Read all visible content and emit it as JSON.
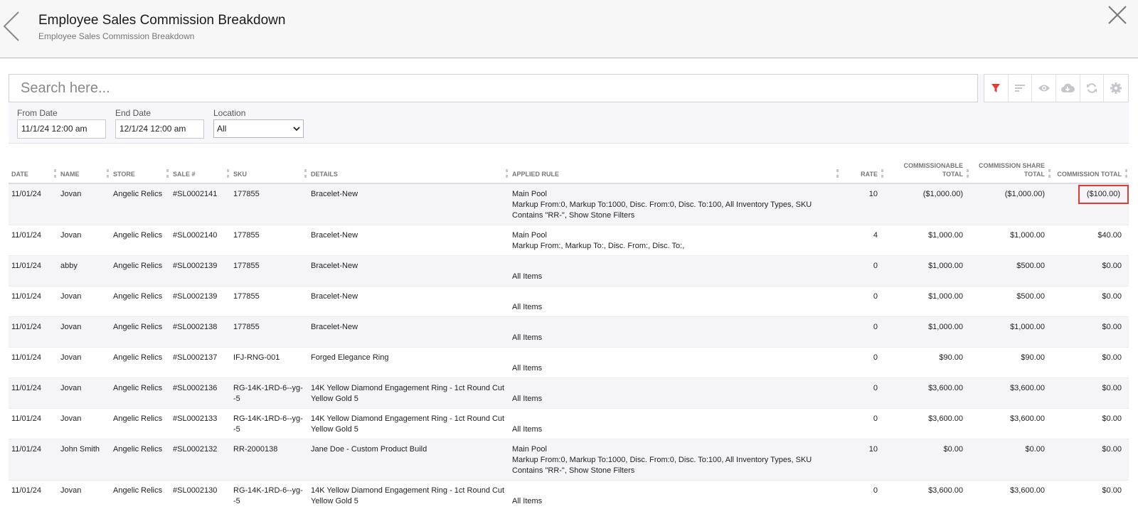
{
  "header": {
    "title": "Employee Sales Commission Breakdown",
    "subtitle": "Employee Sales Commission Breakdown"
  },
  "search": {
    "placeholder": "Search here..."
  },
  "toolbar": {
    "icons": [
      "filter-icon",
      "sort-icon",
      "eye-icon",
      "cloud-download-icon",
      "refresh-icon",
      "gear-icon"
    ],
    "active_color": "#e53935"
  },
  "filters": {
    "from_date_label": "From Date",
    "from_date_value": "11/1/24 12:00 am",
    "end_date_label": "End Date",
    "end_date_value": "12/1/24 12:00 am",
    "location_label": "Location",
    "location_value": "All"
  },
  "table": {
    "columns": [
      "DATE",
      "NAME",
      "STORE",
      "SALE #",
      "SKU",
      "DETAILS",
      "APPLIED RULE",
      "RATE",
      "COMMISSIONABLE TOTAL",
      "COMMISSION SHARE TOTAL",
      "COMMISSION TOTAL"
    ],
    "rows": [
      {
        "date": "11/01/24",
        "name": "Jovan",
        "store": "Angelic Relics",
        "sale": "#SL0002141",
        "sku": "177855",
        "details": "Bracelet-New",
        "rule_name": "Main Pool",
        "rule_desc": "Markup From:0, Markup To:1000, Disc. From:0, Disc. To:100, All Inventory Types, SKU Contains \"RR-\", Show Stone Filters",
        "rate": "10",
        "commissionable": "($1,000.00)",
        "share": "($1,000.00)",
        "commission": "($100.00)"
      },
      {
        "date": "11/01/24",
        "name": "Jovan",
        "store": "Angelic Relics",
        "sale": "#SL0002140",
        "sku": "177855",
        "details": "Bracelet-New",
        "rule_name": "Main Pool",
        "rule_desc": "Markup From:, Markup To:, Disc. From:, Disc. To:,",
        "rate": "4",
        "commissionable": "$1,000.00",
        "share": "$1,000.00",
        "commission": "$40.00"
      },
      {
        "date": "11/01/24",
        "name": "abby",
        "store": "Angelic Relics",
        "sale": "#SL0002139",
        "sku": "177855",
        "details": "Bracelet-New",
        "rule_name": "",
        "rule_desc": "All Items",
        "rate": "0",
        "commissionable": "$1,000.00",
        "share": "$500.00",
        "commission": "$0.00"
      },
      {
        "date": "11/01/24",
        "name": "Jovan",
        "store": "Angelic Relics",
        "sale": "#SL0002139",
        "sku": "177855",
        "details": "Bracelet-New",
        "rule_name": "",
        "rule_desc": "All Items",
        "rate": "0",
        "commissionable": "$1,000.00",
        "share": "$500.00",
        "commission": "$0.00"
      },
      {
        "date": "11/01/24",
        "name": "Jovan",
        "store": "Angelic Relics",
        "sale": "#SL0002138",
        "sku": "177855",
        "details": "Bracelet-New",
        "rule_name": "",
        "rule_desc": "All Items",
        "rate": "0",
        "commissionable": "$1,000.00",
        "share": "$1,000.00",
        "commission": "$0.00"
      },
      {
        "date": "11/01/24",
        "name": "Jovan",
        "store": "Angelic Relics",
        "sale": "#SL0002137",
        "sku": "IFJ-RNG-001",
        "details": "Forged Elegance Ring",
        "rule_name": "",
        "rule_desc": "All Items",
        "rate": "0",
        "commissionable": "$90.00",
        "share": "$90.00",
        "commission": "$0.00"
      },
      {
        "date": "11/01/24",
        "name": "Jovan",
        "store": "Angelic Relics",
        "sale": "#SL0002136",
        "sku": "RG-14K-1RD-6--yg--5",
        "details": "14K Yellow Diamond Engagement Ring - 1ct Round Cut Yellow Gold 5",
        "rule_name": "",
        "rule_desc": "All Items",
        "rate": "0",
        "commissionable": "$3,600.00",
        "share": "$3,600.00",
        "commission": "$0.00"
      },
      {
        "date": "11/01/24",
        "name": "Jovan",
        "store": "Angelic Relics",
        "sale": "#SL0002133",
        "sku": "RG-14K-1RD-6--yg--5",
        "details": "14K Yellow Diamond Engagement Ring - 1ct Round Cut Yellow Gold 5",
        "rule_name": "",
        "rule_desc": "All Items",
        "rate": "0",
        "commissionable": "$3,600.00",
        "share": "$3,600.00",
        "commission": "$0.00"
      },
      {
        "date": "11/01/24",
        "name": "John Smith",
        "store": "Angelic Relics",
        "sale": "#SL0002132",
        "sku": "RR-2000138",
        "details": "Jane Doe - Custom Product Build",
        "rule_name": "Main Pool",
        "rule_desc": "Markup From:0, Markup To:1000, Disc. From:0, Disc. To:100, All Inventory Types, SKU Contains \"RR-\", Show Stone Filters",
        "rate": "10",
        "commissionable": "$0.00",
        "share": "$0.00",
        "commission": "$0.00"
      },
      {
        "date": "11/01/24",
        "name": "Jovan",
        "store": "Angelic Relics",
        "sale": "#SL0002130",
        "sku": "RG-14K-1RD-6--yg--5",
        "details": "14K Yellow Diamond Engagement Ring - 1ct Round Cut Yellow Gold 5",
        "rule_name": "",
        "rule_desc": "All Items",
        "rate": "0",
        "commissionable": "$3,600.00",
        "share": "$3,600.00",
        "commission": "$0.00"
      }
    ]
  }
}
